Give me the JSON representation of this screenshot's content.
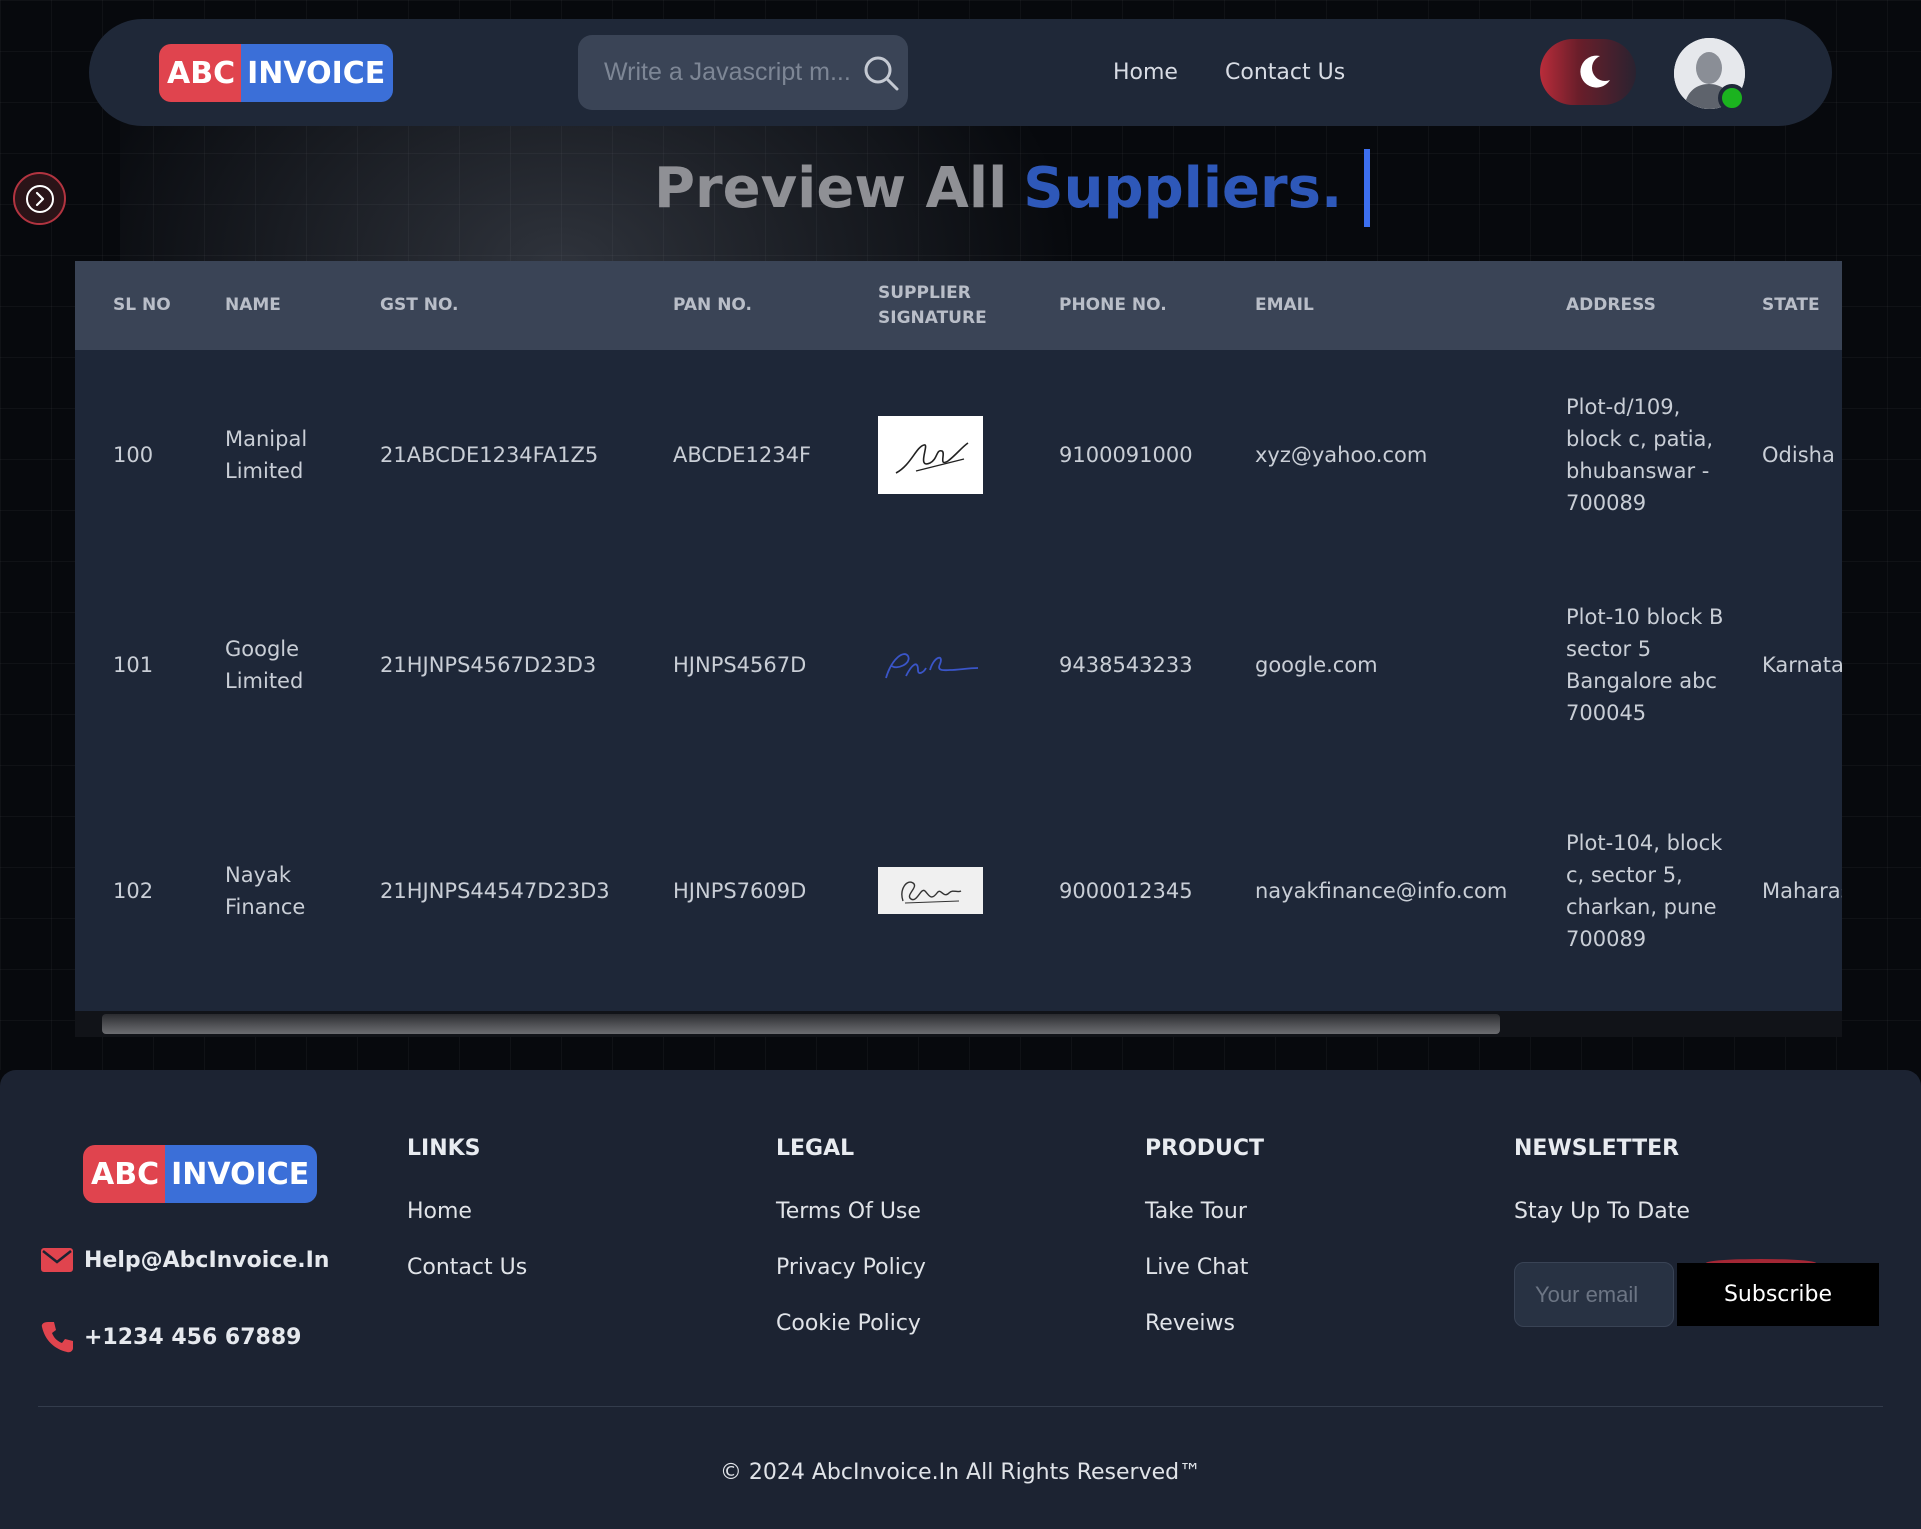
{
  "brand": {
    "part1": "ABC",
    "part2": "INVOICE"
  },
  "search": {
    "placeholder": "Write a Javascript m..."
  },
  "nav": {
    "home": "Home",
    "contact": "Contact Us"
  },
  "title": {
    "part1": "Preview All",
    "part2": "Suppliers."
  },
  "table": {
    "headers": {
      "sl": "SL NO",
      "name": "NAME",
      "gst": "GST NO.",
      "pan": "PAN NO.",
      "signature": "SUPPLIER SIGNATURE",
      "phone": "PHONE NO.",
      "email": "EMAIL",
      "address": "ADDRESS",
      "state": "STATE"
    },
    "rows": [
      {
        "sl": "100",
        "name": "Manipal Limited",
        "gst": "21ABCDE1234FA1Z5",
        "pan": "ABCDE1234F",
        "phone": "9100091000",
        "email": "xyz@yahoo.com",
        "address": "Plot-d/109, block c, patia, bhubanswar - 700089",
        "state": "Odisha"
      },
      {
        "sl": "101",
        "name": "Google Limited",
        "gst": "21HJNPS4567D23D3",
        "pan": "HJNPS4567D",
        "phone": "9438543233",
        "email": "google.com",
        "address": "Plot-10 block B sector 5 Bangalore abc 700045",
        "state": "Karnataka"
      },
      {
        "sl": "102",
        "name": "Nayak Finance",
        "gst": "21HJNPS44547D23D3",
        "pan": "HJNPS7609D",
        "phone": "9000012345",
        "email": "nayakfinance@info.com",
        "address": "Plot-104, block c, sector 5, charkan, pune 700089",
        "state": "Maharashtra"
      }
    ]
  },
  "footer": {
    "email": "Help@AbcInvoice.In",
    "phone": "+1234 456 67889",
    "links": {
      "heading": "LINKS",
      "items": [
        "Home",
        "Contact Us"
      ]
    },
    "legal": {
      "heading": "LEGAL",
      "items": [
        "Terms Of Use",
        "Privacy Policy",
        "Cookie Policy"
      ]
    },
    "product": {
      "heading": "PRODUCT",
      "items": [
        "Take Tour",
        "Live Chat",
        "Reveiws"
      ]
    },
    "newsletter": {
      "heading": "NEWSLETTER",
      "subtitle": "Stay Up To Date",
      "placeholder": "Your email",
      "button": "Subscribe"
    },
    "copyright": "© 2024 AbcInvoice.In All Rights Reserved™"
  },
  "colors": {
    "brand_red": "#e0444e",
    "brand_blue": "#3b6fd8",
    "title_accent": "#2e58b9",
    "online": "#1bb31f"
  }
}
